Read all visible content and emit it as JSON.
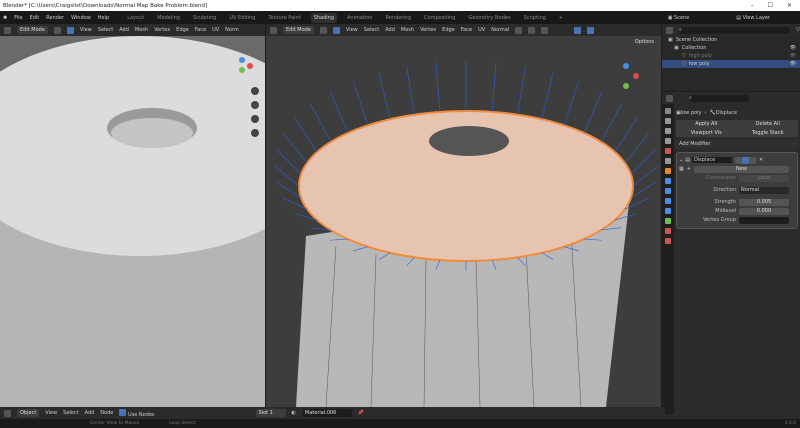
{
  "title": "Blender* [C:\\Users\\Craigslist\\Downloads\\Normal Map Bake Problem.blend]",
  "menu": [
    "File",
    "Edit",
    "Render",
    "Window",
    "Help"
  ],
  "workspaces": [
    "Layout",
    "Modeling",
    "Sculpting",
    "UV Editing",
    "Texture Paint",
    "Shading",
    "Animation",
    "Rendering",
    "Compositing",
    "Geometry Nodes",
    "Scripting",
    "+"
  ],
  "active_workspace": "Shading",
  "scene": "Scene",
  "view_layer": "View Layer",
  "viewport_left": {
    "mode": "Edit Mode",
    "menus": [
      "View",
      "Select",
      "Add",
      "Mesh",
      "Vertex",
      "Edge",
      "Face",
      "UV"
    ],
    "orientation": "Norm"
  },
  "viewport_right": {
    "mode": "Edit Mode",
    "menus": [
      "View",
      "Select",
      "Add",
      "Mesh",
      "Vertex",
      "Edge",
      "Face",
      "UV"
    ],
    "orientation": "Normal",
    "options": "Options"
  },
  "outliner": {
    "items": [
      {
        "label": "Scene Collection"
      },
      {
        "label": "Collection"
      },
      {
        "label": "high poly"
      },
      {
        "label": "low poly"
      }
    ]
  },
  "properties": {
    "breadcrumb_object": "low poly",
    "breadcrumb_modifier": "Displace",
    "apply_all": "Apply All",
    "delete_all": "Delete All",
    "viewport_vis": "Viewport Vis",
    "toggle_stack": "Toggle Stack",
    "add_modifier": "Add Modifier",
    "modifier_name": "Displace",
    "new_label": "New",
    "coordinates_label": "Coordinates",
    "coordinates_value": "Local",
    "direction_label": "Direction",
    "direction_value": "Normal",
    "strength_label": "Strength",
    "strength_value": "0.005",
    "midlevel_label": "Midlevel",
    "midlevel_value": "0.000",
    "vertex_group_label": "Vertex Group"
  },
  "node_editor": {
    "mode": "Object",
    "menus": [
      "View",
      "Select",
      "Add",
      "Node"
    ],
    "use_nodes": "Use Nodes",
    "slot": "Slot 1",
    "material": "Material.006"
  },
  "status": {
    "center_view": "Center View to Mouse",
    "loop_select": "Loop Select",
    "version": "3.0.0"
  }
}
